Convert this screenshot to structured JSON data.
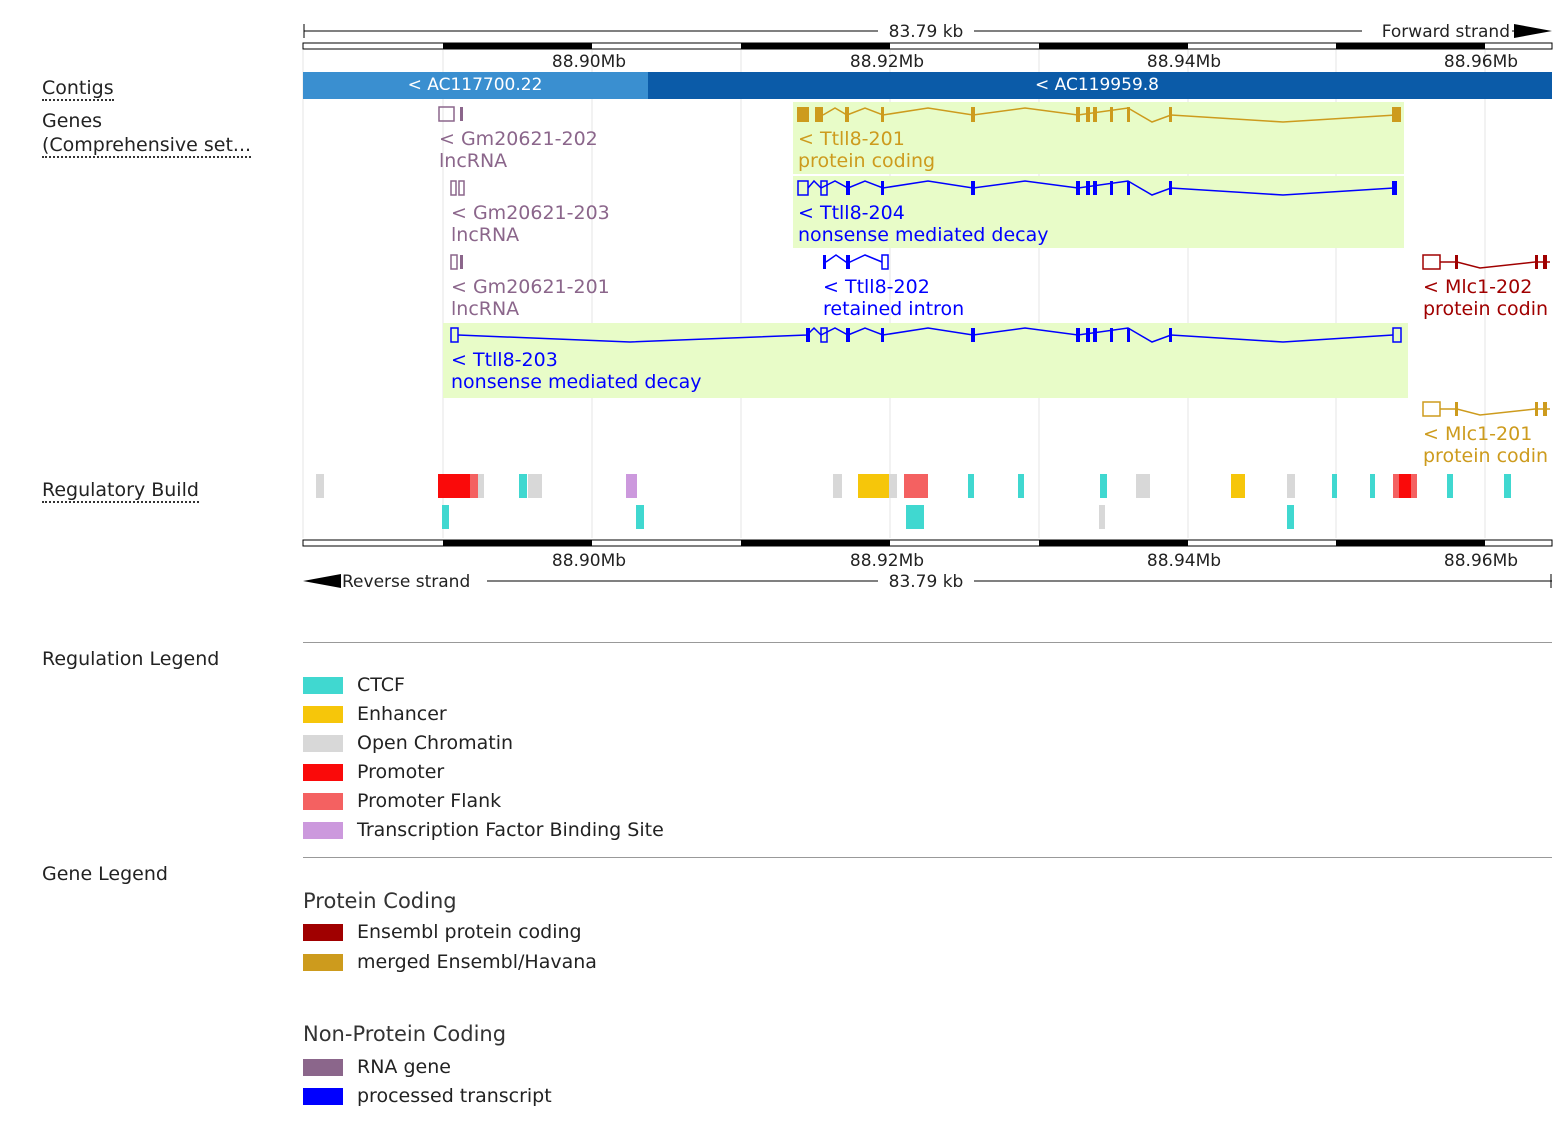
{
  "track_labels": {
    "contigs": "Contigs",
    "genes_line1": "Genes",
    "genes_line2": "(Comprehensive set...",
    "regulatory": "Regulatory Build",
    "regulation_legend": "Regulation Legend",
    "gene_legend": "Gene Legend"
  },
  "ruler": {
    "span_top": "83.79 kb",
    "forward": "Forward strand",
    "span_bottom": "83.79 kb",
    "reverse": "Reverse strand",
    "ticks": [
      "88.90Mb",
      "88.92Mb",
      "88.94Mb",
      "88.96Mb"
    ]
  },
  "contigs": [
    {
      "label": "< AC117700.22",
      "color": "#3a8fd0"
    },
    {
      "label": "< AC119959.8",
      "color": "#0b5ba8"
    }
  ],
  "transcripts": {
    "gm202_name": "< Gm20621-202",
    "gm202_type": "lncRNA",
    "gm203_name": "< Gm20621-203",
    "gm203_type": "lncRNA",
    "gm201_name": "< Gm20621-201",
    "gm201_type": "lncRNA",
    "t201_name": "< Ttll8-201",
    "t201_type": "protein coding",
    "t204_name": "< Ttll8-204",
    "t204_type": "nonsense mediated decay",
    "t202_name": "< Ttll8-202",
    "t202_type": "retained intron",
    "t203_name": "< Ttll8-203",
    "t203_type": "nonsense mediated decay",
    "m202_name": "< Mlc1-202",
    "m202_type": "protein codin",
    "m201_name": "< Mlc1-201",
    "m201_type": "protein codin"
  },
  "colors": {
    "ctcf": "#40d8d0",
    "enhancer": "#f6c60a",
    "open_chromatin": "#d8d8d8",
    "promoter": "#fa0a0a",
    "promoter_flank": "#f46161",
    "tfbs": "#cc99dd",
    "ensembl_protein_coding": "#a00000",
    "merged": "#cd9b1d",
    "rna_gene": "#8b668b",
    "processed_transcript": "#0000ff",
    "highlight": "#e8fcc8"
  },
  "regulation_legend": [
    {
      "label": "CTCF",
      "color": "#40d8d0"
    },
    {
      "label": "Enhancer",
      "color": "#f6c60a"
    },
    {
      "label": "Open Chromatin",
      "color": "#d8d8d8"
    },
    {
      "label": "Promoter",
      "color": "#fa0a0a"
    },
    {
      "label": "Promoter Flank",
      "color": "#f46161"
    },
    {
      "label": "Transcription Factor Binding Site",
      "color": "#cc99dd"
    }
  ],
  "gene_legend": {
    "protein_coding_head": "Protein Coding",
    "protein_coding": [
      {
        "label": "Ensembl protein coding",
        "color": "#a00000"
      },
      {
        "label": "merged Ensembl/Havana",
        "color": "#cd9b1d"
      }
    ],
    "non_protein_coding_head": "Non-Protein Coding",
    "non_protein_coding": [
      {
        "label": "RNA gene",
        "color": "#8b668b"
      },
      {
        "label": "processed transcript",
        "color": "#0000ff"
      }
    ]
  }
}
